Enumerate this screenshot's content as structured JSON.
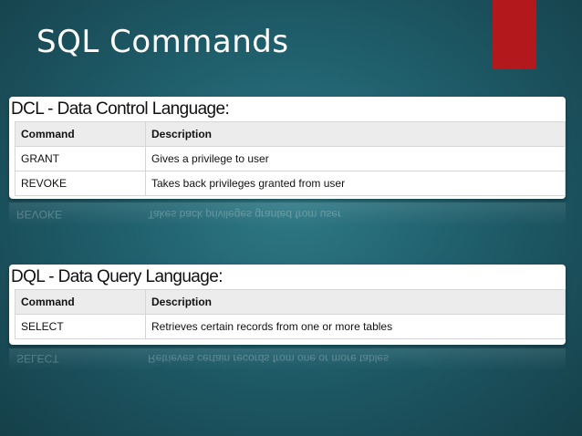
{
  "slide": {
    "title": "SQL Commands",
    "accent_color": "#b3181d"
  },
  "dcl": {
    "heading": "DCL - Data Control Language:",
    "headers": [
      "Command",
      "Description"
    ],
    "rows": [
      [
        "GRANT",
        "Gives a privilege to user"
      ],
      [
        "REVOKE",
        "Takes back privileges granted from user"
      ]
    ]
  },
  "dql": {
    "heading": "DQL - Data Query Language:",
    "headers": [
      "Command",
      "Description"
    ],
    "rows": [
      [
        "SELECT",
        "Retrieves certain records from one or more tables"
      ]
    ]
  }
}
